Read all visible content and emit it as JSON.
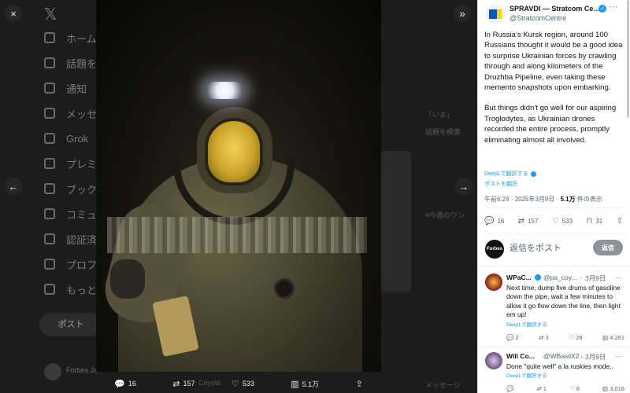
{
  "background": {
    "nav_items": [
      "ホーム",
      "話題を検索",
      "通知",
      "メッセージ",
      "Grok",
      "プレミアム",
      "ブックマーク",
      "コミュニティ",
      "認証済み組織",
      "プロフィール",
      "もっと見る"
    ],
    "nav_post_label": "ポスト",
    "right_snippets": [
      "「いま」",
      "話題を検索",
      "#今週のワン",
      "メッセージ"
    ],
    "bottom_user": "Forbes Ja",
    "bottom_snippet": "Coyote"
  },
  "viewer": {
    "close_icon": "×",
    "collapse_icon": "»",
    "prev_icon": "←",
    "next_icon": "→",
    "actions": {
      "replies": "16",
      "reposts": "157",
      "likes": "533",
      "views": "5.1万"
    }
  },
  "tweet": {
    "author_name": "SPRAVDI — Stratcom Centre",
    "author_handle": "@StratcomCentre",
    "paragraph1": "In Russia's Kursk region, around 100 Russians thought it would be a good idea to surprise Ukrainian forces by crawling through and along kilometers of the Druzhba Pipeline, even taking these memento snapshots upon embarking.",
    "paragraph2": "But things didn't go well for our aspiring Troglodytes, as Ukrainian drones recorded the entire process, promptly eliminating almost all involved.",
    "translate_label": "DeepLで翻訳する",
    "translate_post_label": "ポストを翻訳",
    "time": "午前6:24",
    "date": "2025年3月9日",
    "views_count": "5.1万",
    "views_label": "件の表示",
    "stats": {
      "replies": "16",
      "reposts": "157",
      "likes": "533",
      "bookmarks": "31"
    }
  },
  "reply_box": {
    "avatar_text": "Forbes",
    "placeholder": "返信をポスト",
    "button_label": "返信"
  },
  "replies": [
    {
      "name": "WPaC...",
      "handle": "@pa_coy...",
      "date": "3月9日",
      "text": "Next time, dump five drums of gasoline down the pipe, wait a few minutes to allow it go flow  down the line, then light em up!",
      "translate": "DeepLで翻訳する",
      "stats": {
        "replies": "2",
        "reposts": "3",
        "likes": "28",
        "views": "4,261"
      }
    },
    {
      "name": "Will Co...",
      "handle": "@WBasilX2...",
      "date": "3月9日",
      "text": "Done \"quite well\" a la ruskies mode,.",
      "translate": "DeepLで翻訳する",
      "stats": {
        "replies": "",
        "reposts": "1",
        "likes": "8",
        "views": "3,016"
      }
    }
  ],
  "colors": {
    "accent": "#1d9bf0",
    "panel_bg": "#ffffff",
    "viewer_bg": "#000000"
  }
}
